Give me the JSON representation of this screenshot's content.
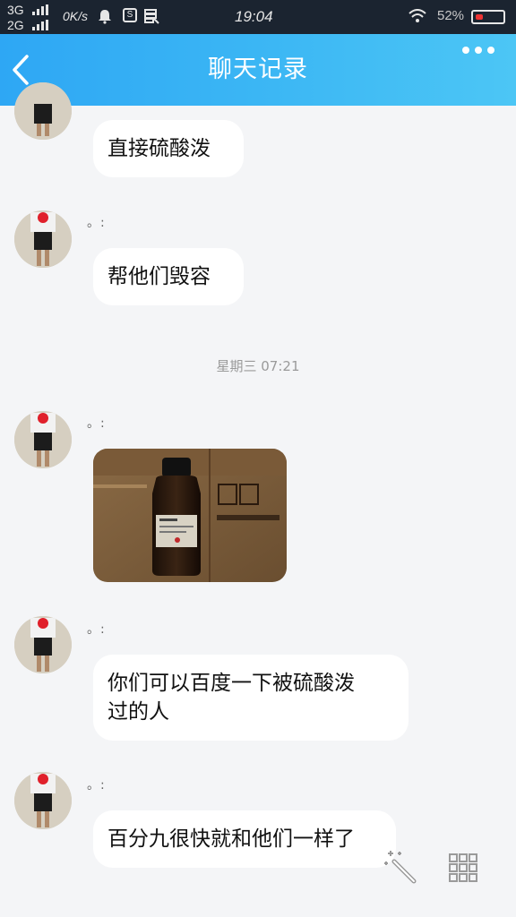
{
  "status_bar": {
    "network_1": "3G",
    "network_2": "2G",
    "speed": "0K/s",
    "sim_icon_label": "S",
    "time": "19:04",
    "battery_text": "52%",
    "icons": [
      "signal-bars-icon",
      "bell-icon",
      "sim-icon",
      "storage-icon",
      "wifi-icon",
      "battery-icon"
    ]
  },
  "header": {
    "title": "聊天记录",
    "back_icon": "chevron-left-icon",
    "more_icon": "more-dots-icon",
    "background": "#2fa8f4"
  },
  "messages": [
    {
      "type": "text",
      "text": "直接硫酸泼"
    },
    {
      "type": "text",
      "nickname": "。:",
      "text": "帮他们毁容"
    },
    {
      "type": "time",
      "text": "星期三 07:21"
    },
    {
      "type": "image",
      "nickname": "。:",
      "image": "photo-of-brown-reagent-bottle-on-cardboard-boxes"
    },
    {
      "type": "text",
      "nickname": "。:",
      "text": "你们可以百度一下被硫酸泼\n过的人"
    },
    {
      "type": "text",
      "nickname": "。:",
      "text": "百分九很快就和他们一样了"
    }
  ],
  "floating_actions": {
    "left_icon": "magic-wand-icon",
    "right_icon": "grid-keyboard-icon"
  }
}
